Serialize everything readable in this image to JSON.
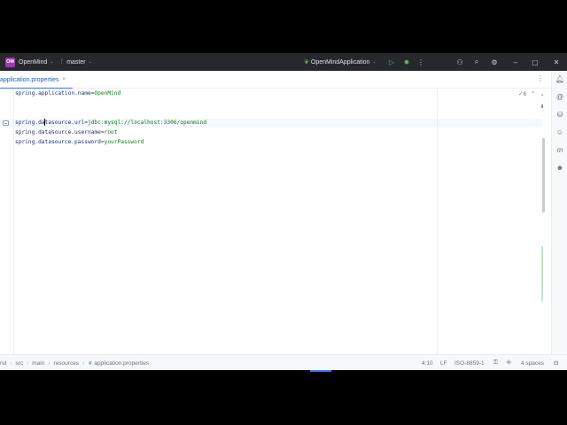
{
  "titlebar": {
    "project_badge": "OM",
    "project_name": "OpenMind",
    "branch": "master",
    "run_config": "OpenMindApplication"
  },
  "tab": {
    "label": "application.properties",
    "close_glyph": "×"
  },
  "editor": {
    "inspection_count": "6",
    "lines": [
      {
        "key": "spring.application.name",
        "eq": "=",
        "value": "OpenMind"
      },
      {
        "key_a": "spring.da",
        "key_b": "tasource.url",
        "eq": "=",
        "value": "jdbc:mysql://localhost:3306/openmind"
      },
      {
        "key": "spring.datasource.username",
        "eq": "=",
        "value": "root"
      },
      {
        "key": "spring.datasource.password",
        "eq": "=",
        "value": "yourPassword"
      }
    ]
  },
  "statusbar": {
    "breadcrumbs": [
      "nd",
      "src",
      "main",
      "resources",
      "application.properties"
    ],
    "position": "4:10",
    "line_separator": "LF",
    "encoding": "ISO-8859-1",
    "indent": "4 spaces"
  },
  "icons": {
    "project_badge": "project-badge-icon",
    "branch": "git-branch-icon",
    "run_config": "spring-leaf-icon",
    "run": "run-icon",
    "debug": "debug-icon",
    "more": "more-vertical-icon",
    "profile": "add-user-icon",
    "search": "search-icon",
    "settings": "gear-icon"
  },
  "colors": {
    "titlebar_bg": "#27282c",
    "accent": "#3574f0",
    "property_key": "#1f2f73",
    "property_value": "#067d17"
  }
}
